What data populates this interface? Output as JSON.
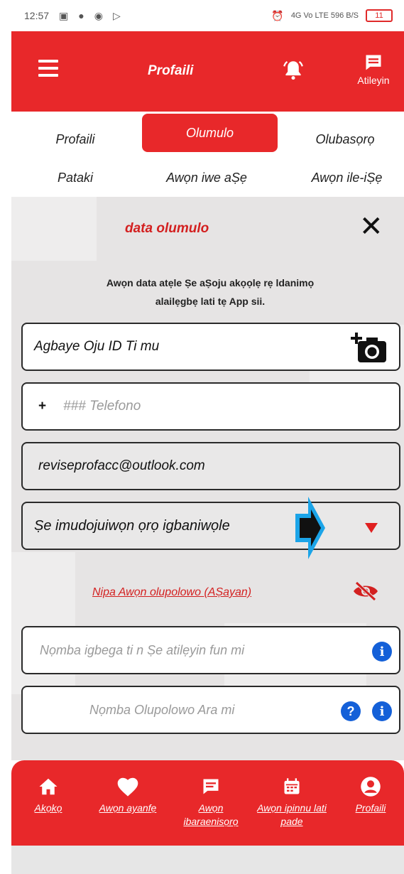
{
  "status_bar": {
    "time": "12:57",
    "left_icons": [
      "screenshot-icon",
      "chat-icon",
      "notification-icon",
      "play-icon"
    ],
    "right_text": "4G Vo LTE 596 B/S",
    "battery": "11"
  },
  "appbar": {
    "title": "Profaili",
    "support_label": "Atileyin"
  },
  "tabs": [
    {
      "label": "Profaili"
    },
    {
      "label": "Olumulo"
    },
    {
      "label": "Olubasọrọ"
    },
    {
      "label": "Pataki"
    },
    {
      "label": "Awọn iwe aṢẹ"
    },
    {
      "label": "Awọn ile-iṢẹ"
    }
  ],
  "panel": {
    "title": "data olumulo",
    "note": "Awọn data atẹle Ṣe aṢoju akọọlẹ rẹ ldanimọ alailẹgbẹ lati tẹ App sii."
  },
  "fields": {
    "face_id": "Agbaye Oju ID  Ti mu",
    "phone_prefix": "+",
    "phone_placeholder": "###   Telefono",
    "email": "reviseprofacc@outlook.com",
    "password_change": "Ṣe imudojuiwọn ọrọ igbaniwọle",
    "agents_link": "Nipa Awọn olupolowo (AṢayan)",
    "promo_placeholder": "Nọmba igbega ti n Ṣe atilẹyin fun mi",
    "agent_number_placeholder": "Nọmba Olupolowo Ara mi"
  },
  "bottom_nav": [
    {
      "label": "Akọkọ",
      "icon": "home-icon"
    },
    {
      "label": "Awọn ayanfẹ",
      "icon": "heart-icon"
    },
    {
      "label": "Awọn ibaraenisọrọ",
      "icon": "message-icon"
    },
    {
      "label": "Awọn ipinnu lati pade",
      "icon": "calendar-icon"
    },
    {
      "label": "Profaili",
      "icon": "user-icon"
    }
  ],
  "colors": {
    "brand_red": "#e8282a",
    "link_red": "#d32020",
    "info_blue": "#1460d8"
  }
}
